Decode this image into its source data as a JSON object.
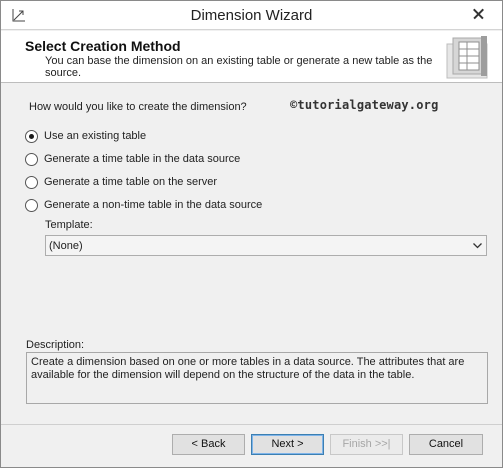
{
  "window": {
    "title": "Dimension Wizard"
  },
  "banner": {
    "title": "Select Creation Method",
    "description": "You can base the dimension on an existing table or generate a new table as the source."
  },
  "content": {
    "question": "How would you like to create the dimension?",
    "watermark": "©tutorialgateway.org",
    "options": [
      {
        "label": "Use an existing table",
        "selected": true
      },
      {
        "label": "Generate a time table in the data source",
        "selected": false
      },
      {
        "label": "Generate a time table on the server",
        "selected": false
      },
      {
        "label": "Generate a non-time table in the data source",
        "selected": false
      }
    ],
    "template": {
      "label": "Template:",
      "value": "(None)"
    },
    "description": {
      "label": "Description:",
      "text": "Create a dimension based on one or more tables in a data source. The attributes that are available for the dimension will depend on the structure of the data in the table."
    }
  },
  "footer": {
    "back_label": "< Back",
    "next_label": "Next >",
    "finish_label": "Finish >>|",
    "cancel_label": "Cancel"
  }
}
